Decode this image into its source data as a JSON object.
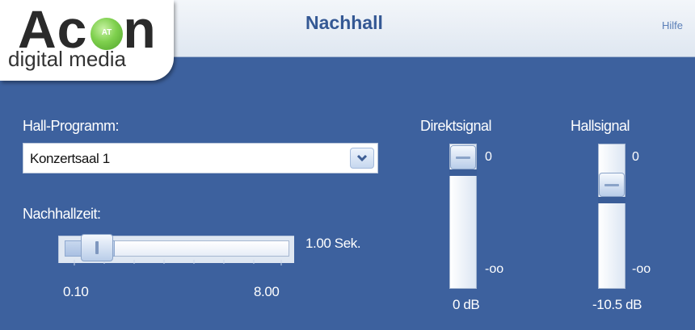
{
  "brand": {
    "logo_main": "Ac",
    "logo_end": "n",
    "logo_dot_text": "AT",
    "logo_sub": "digital media"
  },
  "header": {
    "title": "Nachhall",
    "help_link": "Hilfe"
  },
  "reverb_program": {
    "label": "Hall-Programm:",
    "selected": "Konzertsaal 1"
  },
  "reverb_time": {
    "label": "Nachhallzeit:",
    "value_text": "1.00 Sek.",
    "min_label": "0.10",
    "max_label": "8.00",
    "fraction": 0.1
  },
  "direct_signal": {
    "label": "Direktsignal",
    "top_label": "0",
    "bottom_label": "-oo",
    "value_text": "0 dB",
    "fraction": 1.0
  },
  "reverb_signal": {
    "label": "Hallsignal",
    "top_label": "0",
    "bottom_label": "-oo",
    "value_text": "-10.5 dB",
    "fraction": 0.79
  },
  "colors": {
    "background": "#3d619e",
    "title": "#345894",
    "logo_dot": "#7fd04e"
  }
}
